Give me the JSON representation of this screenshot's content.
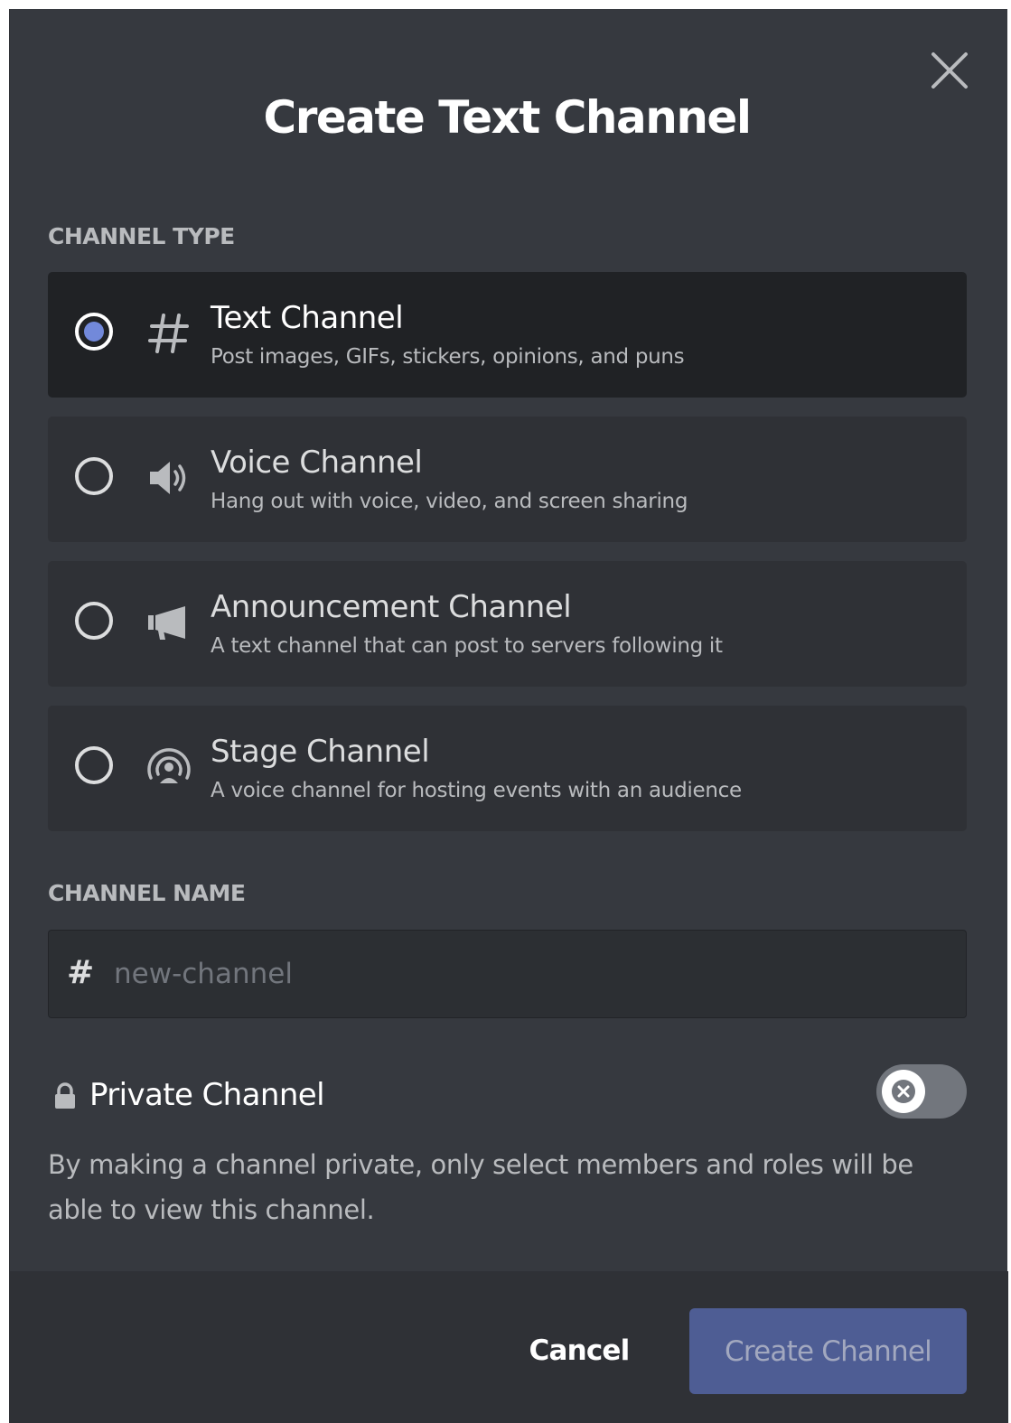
{
  "modal": {
    "title": "Create Text Channel",
    "close_icon": "close-icon"
  },
  "channel_type": {
    "label": "CHANNEL TYPE",
    "selected": "text",
    "options": [
      {
        "id": "text",
        "icon": "hash-icon",
        "title": "Text Channel",
        "description": "Post images, GIFs, stickers, opinions, and puns"
      },
      {
        "id": "voice",
        "icon": "speaker-icon",
        "title": "Voice Channel",
        "description": "Hang out with voice, video, and screen sharing"
      },
      {
        "id": "announcement",
        "icon": "megaphone-icon",
        "title": "Announcement Channel",
        "description": "A text channel that can post to servers following it"
      },
      {
        "id": "stage",
        "icon": "stage-icon",
        "title": "Stage Channel",
        "description": "A voice channel for hosting events with an audience"
      }
    ]
  },
  "channel_name": {
    "label": "CHANNEL NAME",
    "prefix": "#",
    "value": "",
    "placeholder": "new-channel"
  },
  "private": {
    "label": "Private Channel",
    "icon": "lock-icon",
    "enabled": false,
    "description": "By making a channel private, only select members and roles will be able to view this channel."
  },
  "footer": {
    "cancel_label": "Cancel",
    "create_label": "Create Channel"
  },
  "colors": {
    "modal_bg": "#36393f",
    "option_bg": "#2f3136",
    "option_selected_bg": "#202225",
    "radio_selected": "#7289da",
    "create_button_bg": "#4e5d94",
    "create_button_text": "#a2a8bf",
    "muted_text": "#b9bbbe",
    "placeholder": "#72767d"
  }
}
